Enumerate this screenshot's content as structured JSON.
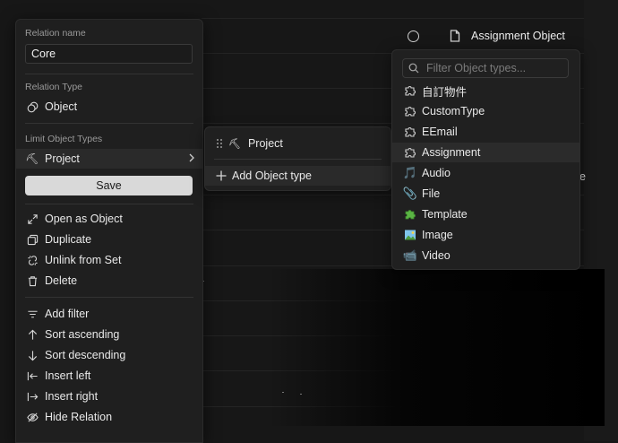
{
  "background": {
    "header_label": "Assignment Object",
    "clipped_text": "e"
  },
  "relation_menu": {
    "name_label": "Relation name",
    "name_value": "Core",
    "type_label": "Relation Type",
    "type_value": "Object",
    "limit_label": "Limit Object Types",
    "limit_value": "Project",
    "save_label": "Save",
    "actions": [
      {
        "label": "Open as Object",
        "icon": "open-external-icon"
      },
      {
        "label": "Duplicate",
        "icon": "duplicate-icon"
      },
      {
        "label": "Unlink from Set",
        "icon": "unlink-icon"
      },
      {
        "label": "Delete",
        "icon": "trash-icon"
      }
    ],
    "view_actions": [
      {
        "label": "Add filter",
        "icon": "filter-icon"
      },
      {
        "label": "Sort ascending",
        "icon": "arrow-up-icon"
      },
      {
        "label": "Sort descending",
        "icon": "arrow-down-icon"
      },
      {
        "label": "Insert left",
        "icon": "insert-left-icon"
      },
      {
        "label": "Insert right",
        "icon": "insert-right-icon"
      },
      {
        "label": "Hide Relation",
        "icon": "eye-off-icon"
      }
    ]
  },
  "object_types_menu": {
    "selected_type": "Project",
    "add_label": "Add Object type"
  },
  "type_picker": {
    "placeholder": "Filter Object types...",
    "items": [
      {
        "label": "自訂物件",
        "icon": "puzzle-icon"
      },
      {
        "label": "CustomType",
        "icon": "puzzle-icon"
      },
      {
        "label": "EEmail",
        "icon": "puzzle-icon"
      },
      {
        "label": "Assignment",
        "icon": "puzzle-icon"
      },
      {
        "label": "Audio",
        "icon": "music-note-icon"
      },
      {
        "label": "File",
        "icon": "paperclip-icon"
      },
      {
        "label": "Template",
        "icon": "green-puzzle-icon"
      },
      {
        "label": "Image",
        "icon": "picture-icon"
      },
      {
        "label": "Video",
        "icon": "video-camera-icon"
      }
    ]
  }
}
